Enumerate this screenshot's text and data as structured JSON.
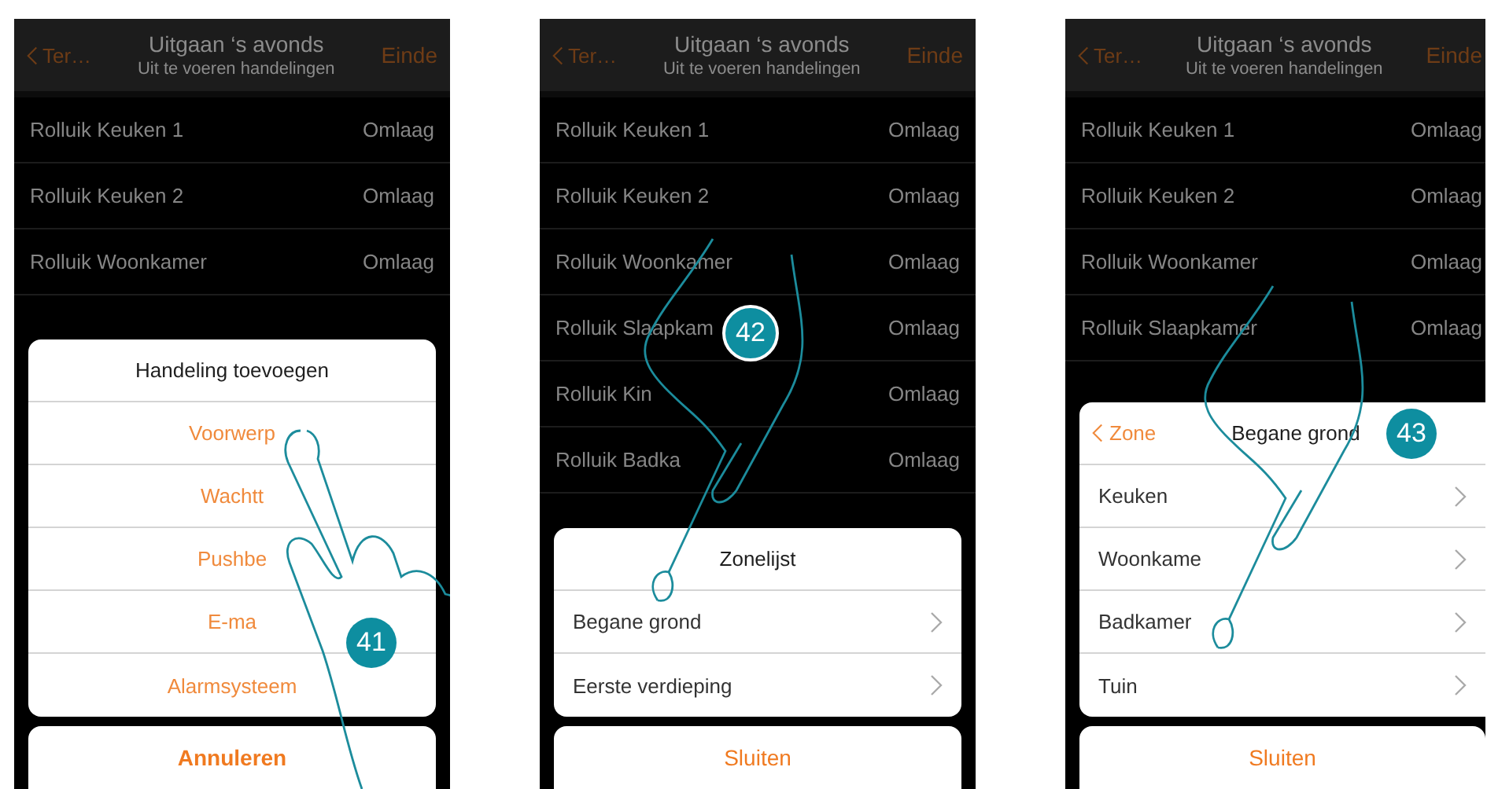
{
  "phones": [
    {
      "header": {
        "back": "Ter…",
        "title": "Uitgaan ‘s avonds",
        "subtitle": "Uit te voeren handelingen",
        "action": "Einde"
      },
      "rows": [
        {
          "name": "Rolluik Keuken 1",
          "value": "Omlaag"
        },
        {
          "name": "Rolluik Keuken 2",
          "value": "Omlaag"
        },
        {
          "name": "Rolluik Woonkamer",
          "value": "Omlaag"
        }
      ],
      "sheet": {
        "kind": "actions",
        "title": "Handeling toevoegen",
        "items": [
          {
            "label": "Voorwerp"
          },
          {
            "label": "Wachtt"
          },
          {
            "label": "Pushbe"
          },
          {
            "label": "E-ma"
          },
          {
            "label": "Alarmsysteem"
          }
        ]
      },
      "cancel": "Annuleren",
      "step": "41"
    },
    {
      "header": {
        "back": "Ter…",
        "title": "Uitgaan ‘s avonds",
        "subtitle": "Uit te voeren handelingen",
        "action": "Einde"
      },
      "rows": [
        {
          "name": "Rolluik Keuken 1",
          "value": "Omlaag"
        },
        {
          "name": "Rolluik Keuken 2",
          "value": "Omlaag"
        },
        {
          "name": "Rolluik Woonkamer",
          "value": "Omlaag"
        },
        {
          "name": "Rolluik Slaapkam",
          "value": "Omlaag"
        },
        {
          "name": "Rolluik Kin",
          "value": "Omlaag"
        },
        {
          "name": "Rolluik Badka",
          "value": "Omlaag"
        }
      ],
      "sheet": {
        "kind": "list",
        "title": "Zonelijst",
        "items": [
          {
            "label": "Begane grond"
          },
          {
            "label": "Eerste verdieping"
          }
        ]
      },
      "cancel": "Sluiten",
      "step": "42"
    },
    {
      "header": {
        "back": "Ter…",
        "title": "Uitgaan ‘s avonds",
        "subtitle": "Uit te voeren handelingen",
        "action": "Einde"
      },
      "rows": [
        {
          "name": "Rolluik Keuken 1",
          "value": "Omlaag"
        },
        {
          "name": "Rolluik Keuken 2",
          "value": "Omlaag"
        },
        {
          "name": "Rolluik Woonkamer",
          "value": "Omlaag"
        },
        {
          "name": "Rolluik Slaapkamer",
          "value": "Omlaag"
        }
      ],
      "sheet": {
        "kind": "list",
        "back": "Zone",
        "title": "Begane grond",
        "items": [
          {
            "label": "Keuken"
          },
          {
            "label": "Woonkame"
          },
          {
            "label": "Badkamer"
          },
          {
            "label": "Tuin"
          }
        ]
      },
      "cancel": "Sluiten",
      "step": "43"
    }
  ]
}
